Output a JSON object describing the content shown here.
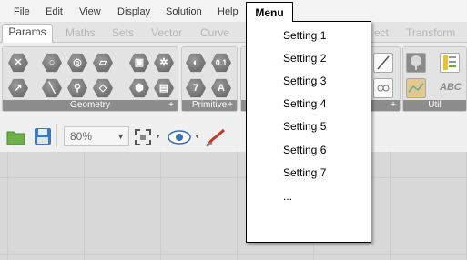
{
  "menubar": {
    "items": [
      "File",
      "Edit",
      "View",
      "Display",
      "Solution",
      "Help"
    ],
    "menu_button": "Menu"
  },
  "tabs": [
    "Params",
    "Maths",
    "Sets",
    "Vector",
    "Curve",
    "ect",
    "Transform"
  ],
  "ribbon": {
    "panels": [
      "Geometry",
      "Primitive",
      "Util"
    ],
    "primitive_glyphs": [
      "0.1",
      "7",
      "A"
    ],
    "util_glyph": "ABC"
  },
  "toolbar": {
    "zoom": "80%"
  },
  "dropdown": {
    "items": [
      "Setting 1",
      "Setting 2",
      "Setting 3",
      "Setting 4",
      "Setting 5",
      "Setting 6",
      "Setting 7",
      "..."
    ]
  },
  "colors": {
    "accent_folder": "#6fb04a",
    "accent_save": "#3d78c4",
    "brush": "#c0392b"
  }
}
